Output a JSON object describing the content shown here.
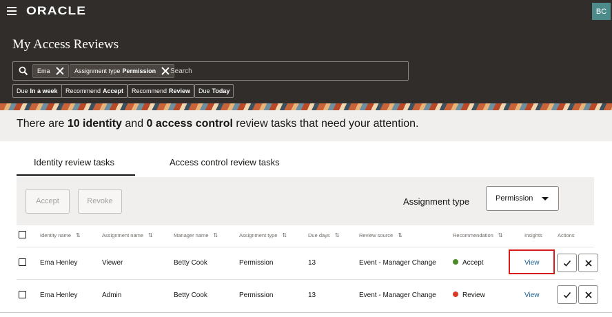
{
  "header": {
    "logo": "ORACLE",
    "avatar_initials": "BC",
    "page_title": "My Access Reviews",
    "search": {
      "chips": [
        {
          "label": "Ema",
          "value": ""
        },
        {
          "label": "Assignment type",
          "value": "Permission"
        }
      ],
      "placeholder": "Search"
    },
    "filters": [
      {
        "label": "Due",
        "value": "In a week"
      },
      {
        "label": "Recommend",
        "value": "Accept"
      },
      {
        "label": "Recommend",
        "value": "Review"
      },
      {
        "label": "Due",
        "value": "Today"
      }
    ]
  },
  "summary": {
    "prefix": "There are ",
    "identity_count": "10 identity",
    "middle": " and ",
    "access_count": "0 access control",
    "suffix": " review tasks that need your attention."
  },
  "tabs": [
    {
      "label": "Identity review tasks",
      "active": true
    },
    {
      "label": "Access control review tasks",
      "active": false
    }
  ],
  "toolbar": {
    "accept_label": "Accept",
    "revoke_label": "Revoke",
    "assignment_type_label": "Assignment type",
    "assignment_type_value": "Permission"
  },
  "table": {
    "columns": [
      "Identity name",
      "Assignment name",
      "Manager name",
      "Assignment type",
      "Due days",
      "Review source",
      "Recommendation",
      "Insights",
      "Actions"
    ],
    "rows": [
      {
        "identity": "Ema Henley",
        "assignment": "Viewer",
        "manager": "Betty Cook",
        "type": "Permission",
        "due": "13",
        "source": "Event - Manager Change",
        "recommendation": "Accept",
        "rec_color": "#4f8a2a",
        "insights": "View"
      },
      {
        "identity": "Ema Henley",
        "assignment": "Admin",
        "manager": "Betty Cook",
        "type": "Permission",
        "due": "13",
        "source": "Event - Manager Change",
        "recommendation": "Review",
        "rec_color": "#d63b25",
        "insights": "View"
      }
    ]
  },
  "colors": {
    "header_bg": "#312d2a",
    "summary_bg": "#f1efed",
    "link": "#1a5c8e",
    "highlight": "#d81a1a"
  }
}
